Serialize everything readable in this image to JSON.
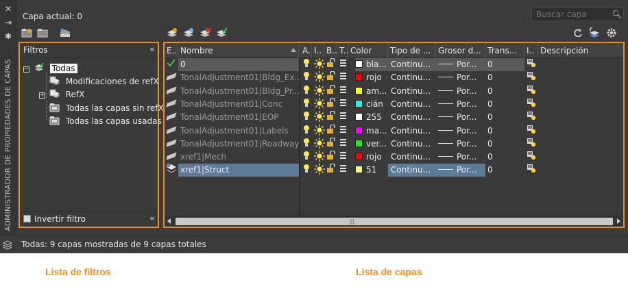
{
  "header": {
    "current_layer": "Capa actual: 0",
    "search_placeholder": "Buscar capa"
  },
  "side_title": "ADMINISTRADOR DE PROPIEDADES DE CAPAS",
  "filters": {
    "title": "Filtros",
    "tree": [
      {
        "label": "Todas",
        "level": 0,
        "selected": true,
        "expander": "−"
      },
      {
        "label": "Modificaciones de refX",
        "level": 1
      },
      {
        "label": "RefX",
        "level": 1,
        "expander": "+"
      },
      {
        "label": "Todas las capas sin refX",
        "level": 1
      },
      {
        "label": "Todas las capas usadas",
        "level": 1
      }
    ],
    "invert_label": "Invertir filtro"
  },
  "layers": {
    "columns": [
      "E..",
      "Nombre",
      "A..",
      "I..",
      "B..",
      "T..",
      "Color",
      "Tipo de ...",
      "Grosor d...",
      "Trans...",
      "I..",
      "Descripción"
    ],
    "rows": [
      {
        "status": "check",
        "name": "0",
        "color": "bla...",
        "swatch": "#ffffff",
        "linetype": "Continu...",
        "lineweight": "Por...",
        "transparency": "0",
        "state": "current"
      },
      {
        "status": "layer",
        "name": "TonalAdjustment01|Bldg_Ex...",
        "color": "rojo",
        "swatch": "#ff0000",
        "linetype": "Continu...",
        "lineweight": "Por...",
        "transparency": "0"
      },
      {
        "status": "layer",
        "name": "TonalAdjustment01|Bldg_Pr...",
        "color": "am...",
        "swatch": "#ffff00",
        "linetype": "Continu...",
        "lineweight": "Por...",
        "transparency": "0"
      },
      {
        "status": "layer",
        "name": "TonalAdjustment01|Conc",
        "color": "cián",
        "swatch": "#00ffff",
        "linetype": "Continu...",
        "lineweight": "Por...",
        "transparency": "0"
      },
      {
        "status": "layer",
        "name": "TonalAdjustment01|EOP",
        "color": "255",
        "swatch": "#ffffff",
        "linetype": "Continu...",
        "lineweight": "Por...",
        "transparency": "0"
      },
      {
        "status": "layer",
        "name": "TonalAdjustment01|Labels",
        "color": "ma...",
        "swatch": "#ff00ff",
        "linetype": "Continu...",
        "lineweight": "Por...",
        "transparency": "0"
      },
      {
        "status": "layer",
        "name": "TonalAdjustment01|Roadway",
        "color": "ver...",
        "swatch": "#00ff00",
        "linetype": "Continu...",
        "lineweight": "Por...",
        "transparency": "0"
      },
      {
        "status": "layer",
        "name": "xref1|Mech",
        "color": "rojo",
        "swatch": "#ff0000",
        "linetype": "Continu...",
        "lineweight": "Por...",
        "transparency": "0"
      },
      {
        "status": "layer-select",
        "name": "xref1|Struct",
        "color": "51",
        "swatch": "#ffff66",
        "linetype": "Continu...",
        "lineweight": "Por...",
        "transparency": "0",
        "state": "selected"
      }
    ]
  },
  "status_bar": "Todas: 9 capas mostradas de 9 capas totales",
  "captions": {
    "filter_list": "Lista de filtros",
    "layer_list": "Lista de capas"
  },
  "colors": {
    "accent": "#f28c18",
    "panel": "#3b3b3b",
    "selection": "#5e7a94"
  }
}
